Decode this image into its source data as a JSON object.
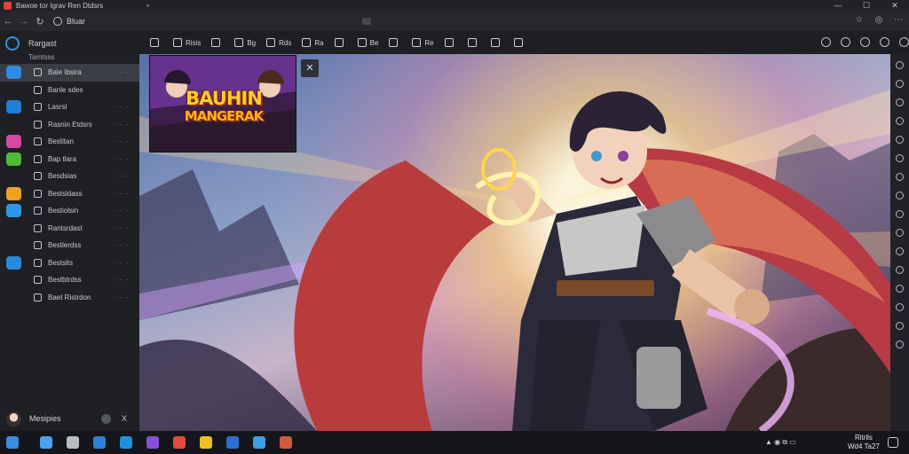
{
  "window": {
    "title": "Bawoe tor Igrav Ren Dtdsrs",
    "controls": [
      "—",
      "☐",
      "✕"
    ]
  },
  "address": {
    "url": "Bluar",
    "nav": [
      "←",
      "→",
      "↻"
    ]
  },
  "sidebar": {
    "header": "Rargast",
    "subheader": "Tamtsss",
    "items": [
      {
        "label": "Bale Ibsira",
        "dots": "· · ·",
        "app_color": "#2f8be0",
        "active": true
      },
      {
        "label": "Banle sdes",
        "dots": "",
        "app_color": "",
        "active": false
      },
      {
        "label": "Lasrsl",
        "dots": "· · ·",
        "app_color": "#1f7fd8",
        "active": false
      },
      {
        "label": "Rasnin Etdsrs",
        "dots": "· · ·",
        "app_color": "",
        "active": false
      },
      {
        "label": "Bestitan",
        "dots": "· · ·",
        "app_color": "#d44aa0",
        "active": false
      },
      {
        "label": "Bap tlara",
        "dots": "· · ·",
        "app_color": "#52b838",
        "active": false
      },
      {
        "label": "Besdsias",
        "dots": "· · ·",
        "app_color": "",
        "active": false
      },
      {
        "label": "Bestsldass",
        "dots": "· · ·",
        "app_color": "#f0a020",
        "active": false
      },
      {
        "label": "Bestiolsin",
        "dots": "· · ·",
        "app_color": "#2a9ae8",
        "active": false
      },
      {
        "label": "Rantsrdast",
        "dots": "· · ·",
        "app_color": "",
        "active": false
      },
      {
        "label": "Bestlerdss",
        "dots": "· · ·",
        "app_color": "",
        "active": false
      },
      {
        "label": "Bestsits",
        "dots": "· · ·",
        "app_color": "#2a8ad8",
        "active": false
      },
      {
        "label": "Bestbtrdss",
        "dots": "· · ·",
        "app_color": "",
        "active": false
      },
      {
        "label": "Baet Ristrdon",
        "dots": "· · ·",
        "app_color": "",
        "active": false
      }
    ],
    "user": {
      "name": "Mesipies",
      "close": "X"
    }
  },
  "toolbar": {
    "tools": [
      "",
      "Risis",
      "",
      "Bg",
      "Rds",
      "Ra",
      "",
      "Be",
      "",
      "Re",
      "",
      "",
      "",
      ""
    ]
  },
  "canvas": {
    "thumbnail": {
      "line1": "BAUHIN",
      "line2": "MANGERAK"
    },
    "expand_icon": "✕"
  },
  "taskbar": {
    "apps": [
      {
        "name": "start",
        "color": "#3a8be0"
      },
      {
        "name": "search",
        "color": "#4aa3f0"
      },
      {
        "name": "task-view",
        "color": "#b9bcc2"
      },
      {
        "name": "files",
        "color": "#2f80d8"
      },
      {
        "name": "edge",
        "color": "#1f8fe0"
      },
      {
        "name": "app-purple",
        "color": "#8a4fd8"
      },
      {
        "name": "chrome",
        "color": "#e04a3a"
      },
      {
        "name": "explorer",
        "color": "#f0c020"
      },
      {
        "name": "store",
        "color": "#2b6fd0"
      },
      {
        "name": "mail",
        "color": "#3ba0e8"
      },
      {
        "name": "game",
        "color": "#d05a3a"
      }
    ],
    "tray": "▲ ◉ ⧉ ▭",
    "clock_time": "Ritrlls",
    "clock_date": "Wd4 Ta27"
  },
  "colors": {
    "accent": "#3d8fd9",
    "sidebar_bg": "#1e2024",
    "taskbar_bg": "#14161b"
  }
}
